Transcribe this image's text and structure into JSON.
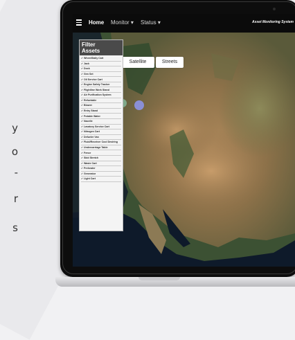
{
  "side_text": {
    "lines": [
      "y",
      "o",
      "-",
      "r",
      "s"
    ]
  },
  "navbar": {
    "items": [
      {
        "label": "Home"
      },
      {
        "label": "Monitor ▾"
      },
      {
        "label": "Status ▾"
      }
    ],
    "brand": "Asset Monitoring System"
  },
  "map": {
    "toggle_buttons": [
      {
        "label": "Satellite"
      },
      {
        "label": "Streets"
      }
    ]
  },
  "filter_panel": {
    "title_line1": "Filter",
    "title_line2": "Assets",
    "items": [
      {
        "label": "Wheel/Daily Cart"
      },
      {
        "label": "Jack"
      },
      {
        "label": "Dock"
      },
      {
        "label": "Gen Set"
      },
      {
        "label": "Oil Service Cart"
      },
      {
        "label": "Engine Safety Tracker"
      },
      {
        "label": "Flightline Work Stand"
      },
      {
        "label": "Air Purification System"
      },
      {
        "label": "Refuelable"
      },
      {
        "label": "Blower"
      },
      {
        "label": "Entry Stand"
      },
      {
        "label": "Potable Water"
      },
      {
        "label": "Nacelle"
      },
      {
        "label": "Lavatory Service Cart"
      },
      {
        "label": "Nitrogen Cart"
      },
      {
        "label": "Defueler Van"
      },
      {
        "label": "Fluid/Receiver Cool Desiring"
      },
      {
        "label": "Undercarriage Table"
      },
      {
        "label": "Fence"
      },
      {
        "label": "Skid Stretch"
      },
      {
        "label": "Waste Cart"
      },
      {
        "label": "Preheater"
      },
      {
        "label": "Generator"
      },
      {
        "label": "Light Cart"
      }
    ]
  },
  "markers": [
    {
      "name": "asset-marker-green",
      "color": "#7fa889"
    },
    {
      "name": "asset-marker-blue",
      "color": "#8a8fd6"
    }
  ]
}
